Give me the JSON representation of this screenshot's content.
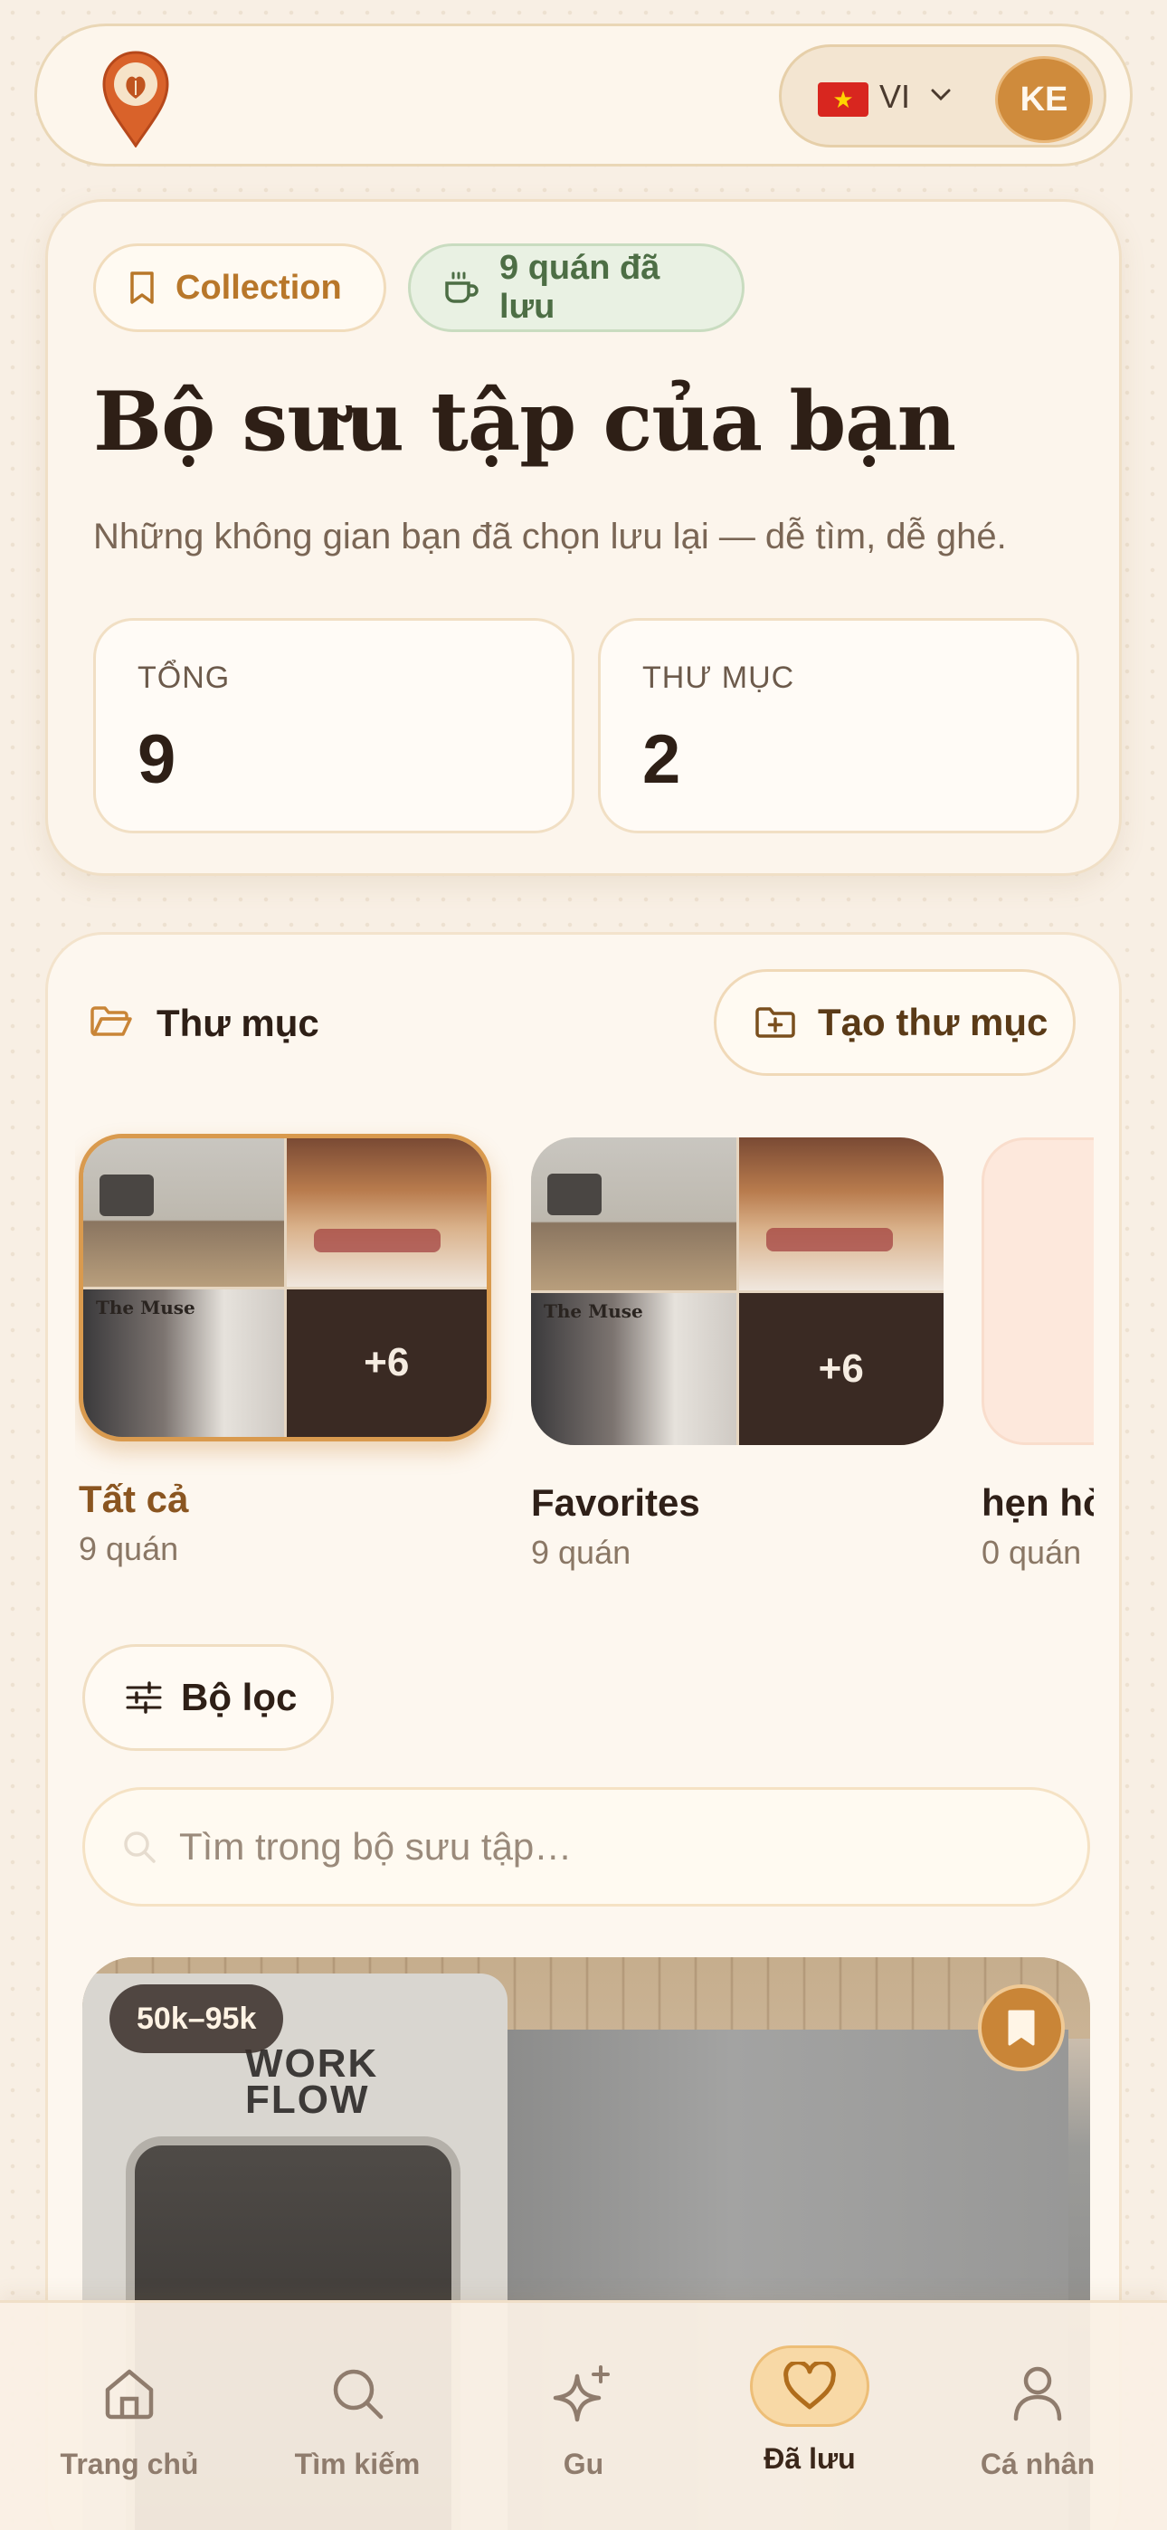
{
  "header": {
    "language_code": "VI",
    "avatar_initials": "KE"
  },
  "hero": {
    "chip_collection": "Collection",
    "chip_saved": "9 quán đã lưu",
    "title": "Bộ sưu tập của bạn",
    "subtitle": "Những không gian bạn đã chọn lưu lại — dễ tìm, dễ ghé.",
    "stats": [
      {
        "label": "TỔNG",
        "value": "9"
      },
      {
        "label": "THƯ MỤC",
        "value": "2"
      }
    ]
  },
  "folders": {
    "title": "Thư mục",
    "new_folder_label": "Tạo thư mục",
    "items": [
      {
        "name": "Tất cả",
        "count": "9 quán",
        "extra": "+6",
        "active": true
      },
      {
        "name": "Favorites",
        "count": "9 quán",
        "extra": "+6",
        "active": false
      },
      {
        "name": "hẹn hò",
        "count": "0 quán",
        "extra": "",
        "active": false
      }
    ]
  },
  "filter": {
    "label": "Bộ lọc"
  },
  "search": {
    "placeholder": "Tìm trong bộ sưu tập…",
    "value": ""
  },
  "cafe_card": {
    "price": "50k–95k",
    "logo_text": "WORK FLOW"
  },
  "bottom_nav": {
    "items": [
      {
        "label": "Trang chủ",
        "icon": "home-icon"
      },
      {
        "label": "Tìm kiếm",
        "icon": "search-icon"
      },
      {
        "label": "Gu",
        "icon": "sparkle-icon"
      },
      {
        "label": "Đã lưu",
        "icon": "heart-icon",
        "active": true
      },
      {
        "label": "Cá nhân",
        "icon": "user-icon"
      }
    ]
  },
  "colors": {
    "accent": "#c98537",
    "brand_brown": "#2e1f16",
    "saved_green": "#4d6e45",
    "background": "#f8efe4"
  }
}
